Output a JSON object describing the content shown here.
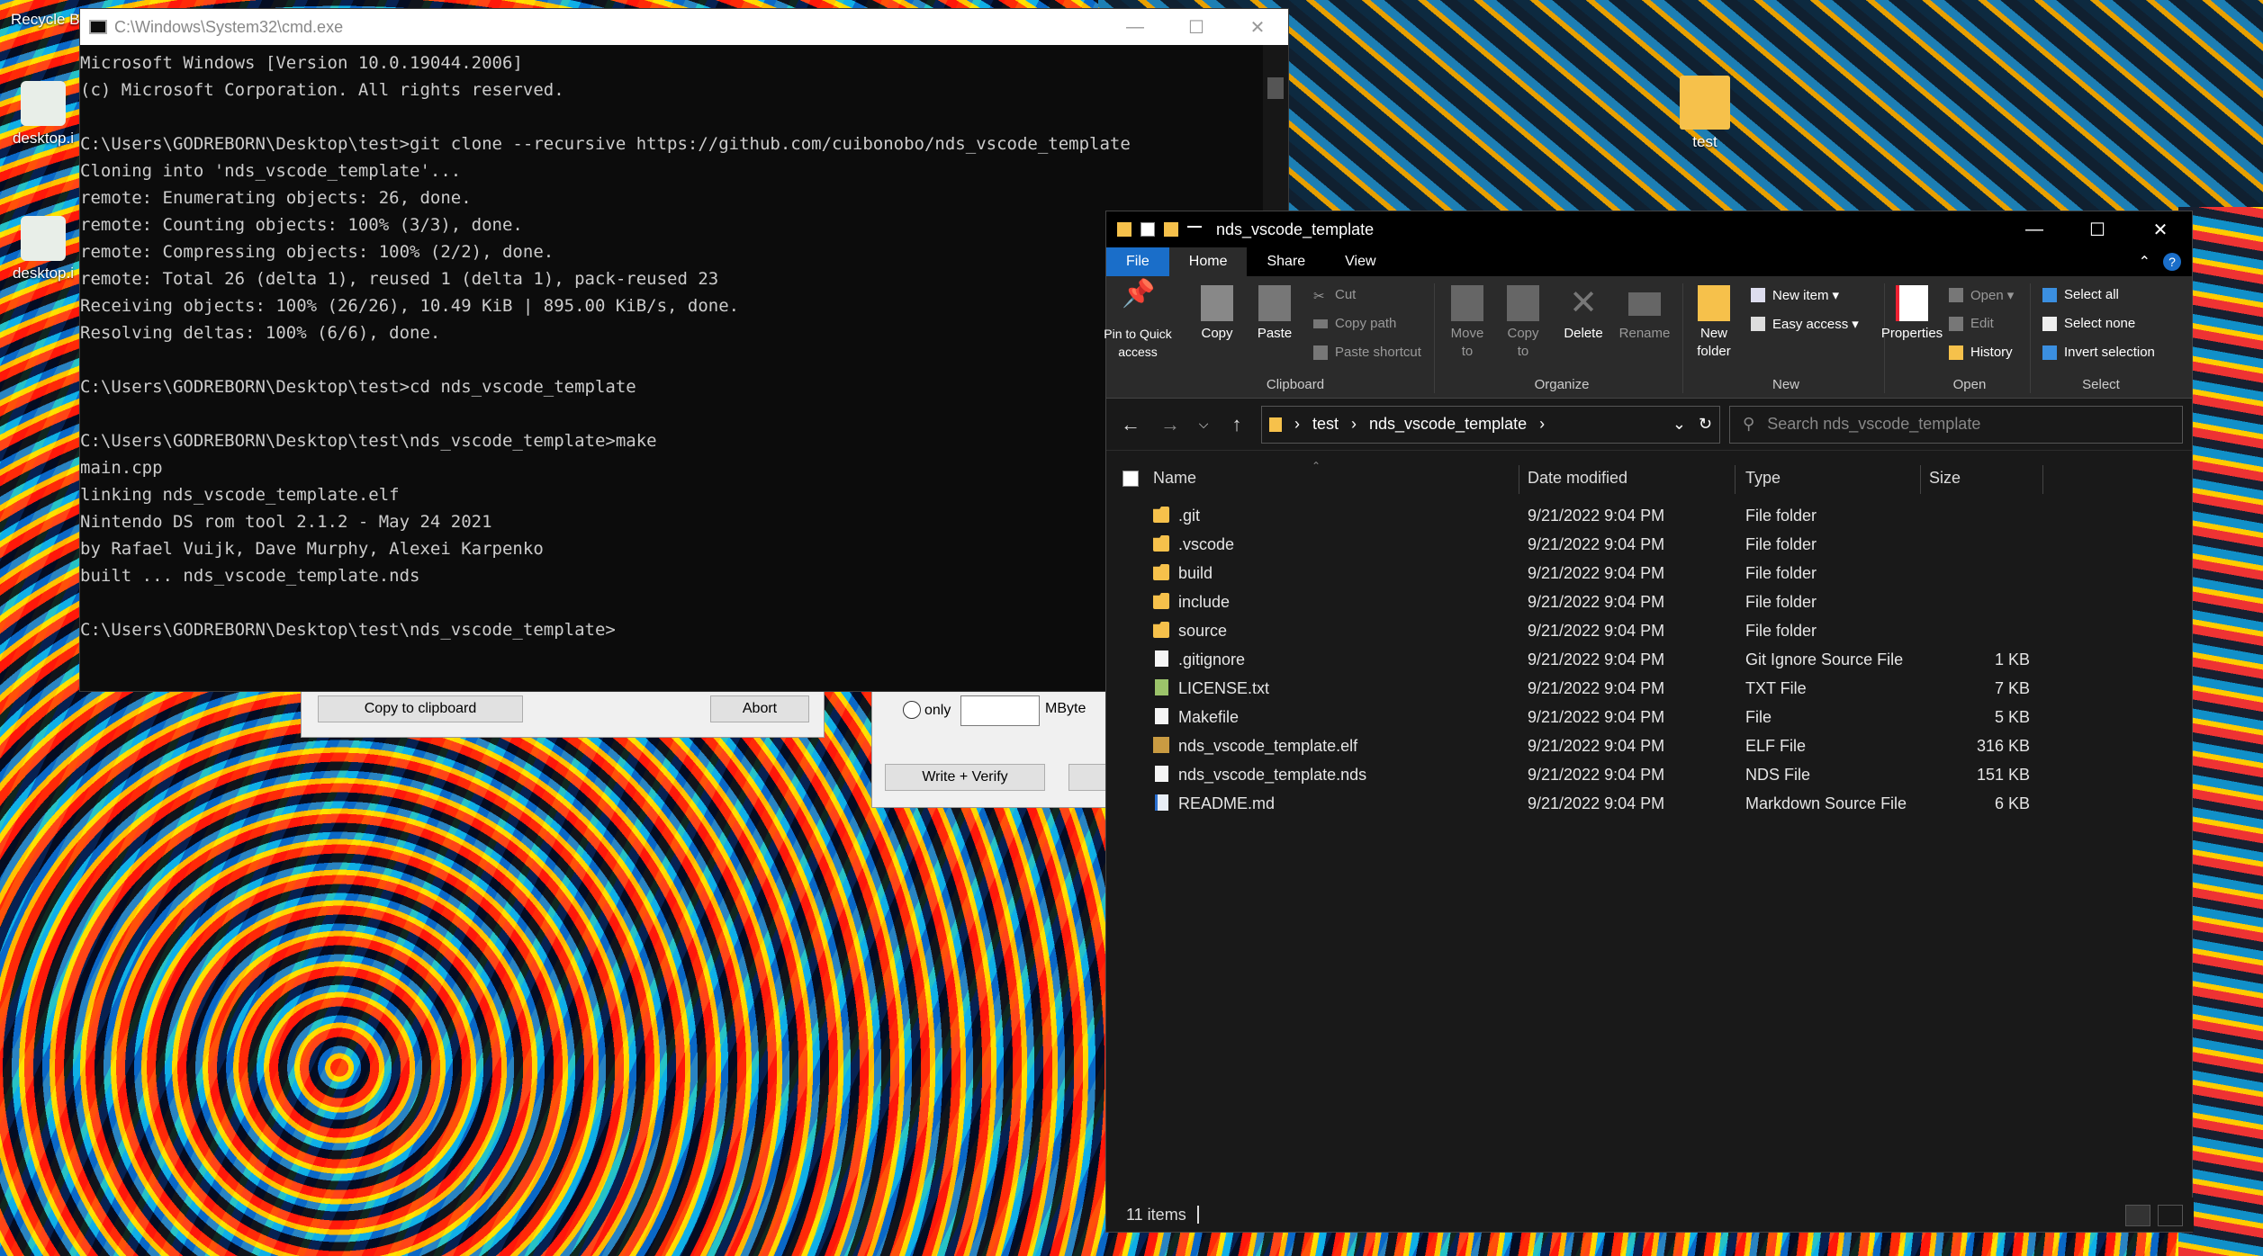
{
  "desktop": {
    "recycle_bin_label": "Recycle B",
    "icons": [
      {
        "label": "desktop.i"
      },
      {
        "label": "desktop.i"
      }
    ],
    "test_folder_label": "test"
  },
  "cmd": {
    "title": "C:\\Windows\\System32\\cmd.exe",
    "lines": [
      "Microsoft Windows [Version 10.0.19044.2006]",
      "(c) Microsoft Corporation. All rights reserved.",
      "",
      "C:\\Users\\GODREBORN\\Desktop\\test>git clone --recursive https://github.com/cuibonobo/nds_vscode_template",
      "Cloning into 'nds_vscode_template'...",
      "remote: Enumerating objects: 26, done.",
      "remote: Counting objects: 100% (3/3), done.",
      "remote: Compressing objects: 100% (2/2), done.",
      "remote: Total 26 (delta 1), reused 1 (delta 1), pack-reused 23",
      "Receiving objects: 100% (26/26), 10.49 KiB | 895.00 KiB/s, done.",
      "Resolving deltas: 100% (6/6), done.",
      "",
      "C:\\Users\\GODREBORN\\Desktop\\test>cd nds_vscode_template",
      "",
      "C:\\Users\\GODREBORN\\Desktop\\test\\nds_vscode_template>make",
      "main.cpp",
      "linking nds_vscode_template.elf",
      "Nintendo DS rom tool 2.1.2 - May 24 2021",
      "by Rafael Vuijk, Dave Murphy, Alexei Karpenko",
      "built ... nds_vscode_template.nds",
      "",
      "C:\\Users\\GODREBORN\\Desktop\\test\\nds_vscode_template>"
    ]
  },
  "dialog1": {
    "copy_label": "Copy to clipboard",
    "abort_label": "Abort"
  },
  "dialog2": {
    "only_label": "only",
    "unit_label": "MByte",
    "write_verify_label": "Write + Verify"
  },
  "explorer": {
    "title": "nds_vscode_template",
    "tabs": [
      "File",
      "Home",
      "Share",
      "View"
    ],
    "ribbon": {
      "pin": "Pin to Quick access",
      "copy": "Copy",
      "paste": "Paste",
      "cut": "Cut",
      "copy_path": "Copy path",
      "paste_shortcut": "Paste shortcut",
      "clipboard": "Clipboard",
      "move_to": "Move to",
      "copy_to": "Copy to",
      "delete": "Delete",
      "rename": "Rename",
      "organize": "Organize",
      "new_folder": "New folder",
      "new_item": "New item",
      "easy_access": "Easy access",
      "new": "New",
      "properties": "Properties",
      "open": "Open",
      "edit": "Edit",
      "history": "History",
      "open_group": "Open",
      "select_all": "Select all",
      "select_none": "Select none",
      "invert_selection": "Invert selection",
      "select": "Select"
    },
    "address": {
      "crumbs": [
        "test",
        "nds_vscode_template"
      ]
    },
    "search_placeholder": "Search nds_vscode_template",
    "columns": {
      "name": "Name",
      "date": "Date modified",
      "type": "Type",
      "size": "Size"
    },
    "files": [
      {
        "name": ".git",
        "date": "9/21/2022 9:04 PM",
        "type": "File folder",
        "size": "",
        "kind": "folder"
      },
      {
        "name": ".vscode",
        "date": "9/21/2022 9:04 PM",
        "type": "File folder",
        "size": "",
        "kind": "folder"
      },
      {
        "name": "build",
        "date": "9/21/2022 9:04 PM",
        "type": "File folder",
        "size": "",
        "kind": "folder"
      },
      {
        "name": "include",
        "date": "9/21/2022 9:04 PM",
        "type": "File folder",
        "size": "",
        "kind": "folder"
      },
      {
        "name": "source",
        "date": "9/21/2022 9:04 PM",
        "type": "File folder",
        "size": "",
        "kind": "folder"
      },
      {
        "name": ".gitignore",
        "date": "9/21/2022 9:04 PM",
        "type": "Git Ignore Source File",
        "size": "1 KB",
        "kind": "doc"
      },
      {
        "name": "LICENSE.txt",
        "date": "9/21/2022 9:04 PM",
        "type": "TXT File",
        "size": "7 KB",
        "kind": "txt"
      },
      {
        "name": "Makefile",
        "date": "9/21/2022 9:04 PM",
        "type": "File",
        "size": "5 KB",
        "kind": "doc"
      },
      {
        "name": "nds_vscode_template.elf",
        "date": "9/21/2022 9:04 PM",
        "type": "ELF File",
        "size": "316 KB",
        "kind": "elf"
      },
      {
        "name": "nds_vscode_template.nds",
        "date": "9/21/2022 9:04 PM",
        "type": "NDS File",
        "size": "151 KB",
        "kind": "doc"
      },
      {
        "name": "README.md",
        "date": "9/21/2022 9:04 PM",
        "type": "Markdown Source File",
        "size": "6 KB",
        "kind": "md"
      }
    ],
    "status": "11 items"
  }
}
